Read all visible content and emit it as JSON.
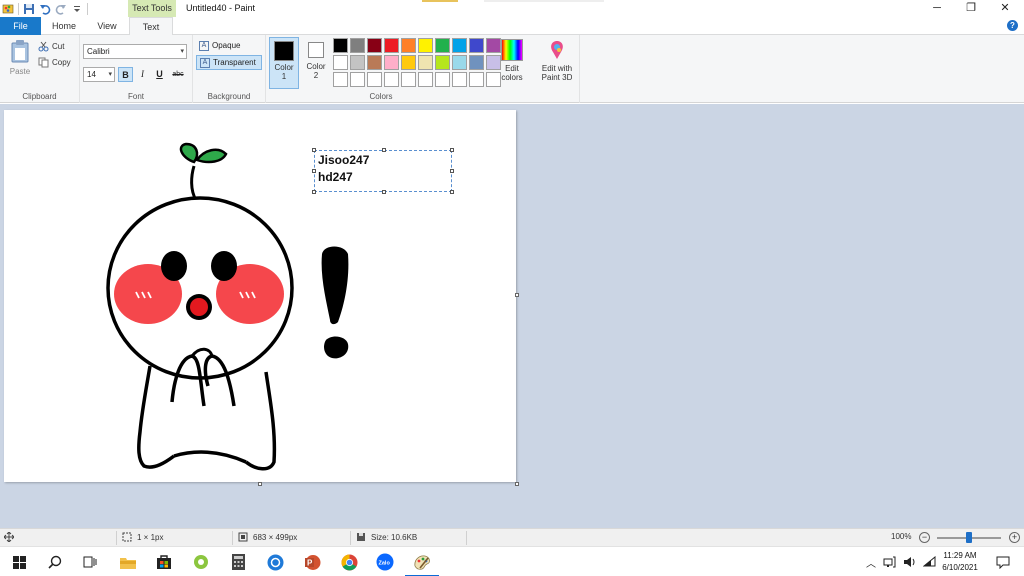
{
  "titlebar": {
    "contextual_tab": "Text Tools",
    "title": "Untitled40 - Paint",
    "minimize_glyph": "─",
    "restore_glyph": "❐",
    "close_glyph": "✕"
  },
  "tabs": {
    "file": "File",
    "home": "Home",
    "view": "View",
    "text": "Text",
    "help_glyph": "?"
  },
  "ribbon": {
    "clipboard": {
      "group_label": "Clipboard",
      "paste": "Paste",
      "cut": "Cut",
      "copy": "Copy"
    },
    "font": {
      "group_label": "Font",
      "family": "Calibri",
      "size": "14",
      "bold": "B",
      "italic": "I",
      "underline": "U",
      "strike": "abc"
    },
    "background": {
      "group_label": "Background",
      "opaque": "Opaque",
      "transparent": "Transparent"
    },
    "colors": {
      "group_label": "Colors",
      "color1_label": "Color",
      "color1_num": "1",
      "color2_label": "Color",
      "color2_num": "2",
      "color1": "#000000",
      "color2": "#ffffff",
      "edit_colors_1": "Edit",
      "edit_colors_2": "colors",
      "paint3d_1": "Edit with",
      "paint3d_2": "Paint 3D",
      "palette": [
        "#000000",
        "#7f7f7f",
        "#880015",
        "#ed1c24",
        "#ff7f27",
        "#fff200",
        "#22b14c",
        "#00a2e8",
        "#3f48cc",
        "#a349a4",
        "#ffffff",
        "#c3c3c3",
        "#b97a57",
        "#ffaec9",
        "#ffc90e",
        "#efe4b0",
        "#b5e61d",
        "#99d9ea",
        "#7092be",
        "#c8bfe7",
        "#ffffff",
        "#ffffff",
        "#ffffff",
        "#ffffff",
        "#ffffff",
        "#ffffff",
        "#ffffff",
        "#ffffff",
        "#ffffff",
        "#ffffff"
      ]
    }
  },
  "canvas": {
    "text_line_1": "Jisoo247",
    "text_line_2": "hd247"
  },
  "statusbar": {
    "selection_size": "1 × 1px",
    "image_size": "683 × 499px",
    "file_size": "Size: 10.6KB",
    "zoom": "100%",
    "zoom_level_percent": 100
  },
  "taskbar": {
    "time": "11:29 AM",
    "date": "6/10/2021",
    "zalo_label": "Zalo"
  }
}
